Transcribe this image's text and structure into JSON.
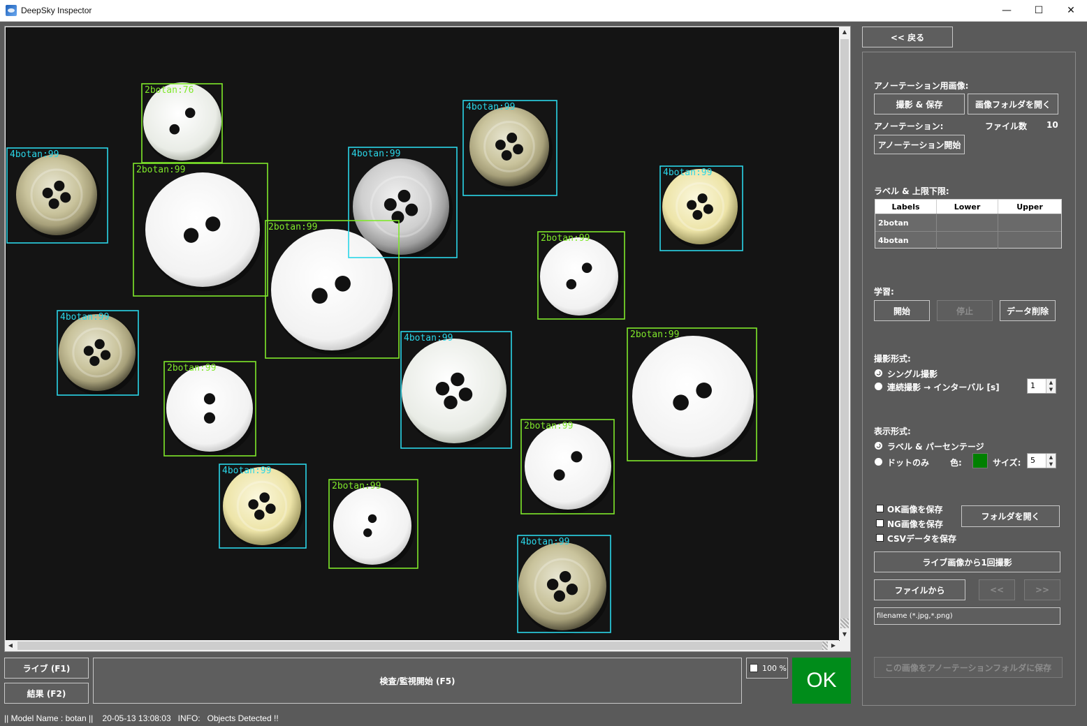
{
  "window": {
    "title": "DeepSky Inspector",
    "minimize_glyph": "—",
    "maximize_glyph": "☐",
    "close_glyph": "✕"
  },
  "viewer": {
    "detections": [
      {
        "label": "2botan:76",
        "class": "2botan"
      },
      {
        "label": "4botan:99",
        "class": "4botan"
      },
      {
        "label": "2botan:99",
        "class": "2botan"
      },
      {
        "label": "4botan:99",
        "class": "4botan"
      },
      {
        "label": "2botan:99",
        "class": "2botan"
      },
      {
        "label": "4botan:99",
        "class": "4botan"
      },
      {
        "label": "4botan:99",
        "class": "4botan"
      },
      {
        "label": "2botan:99",
        "class": "2botan"
      },
      {
        "label": "4botan:99",
        "class": "4botan"
      },
      {
        "label": "2botan:99",
        "class": "2botan"
      },
      {
        "label": "4botan:99",
        "class": "4botan"
      },
      {
        "label": "2botan:99",
        "class": "2botan"
      },
      {
        "label": "2botan:99",
        "class": "2botan"
      },
      {
        "label": "4botan:99",
        "class": "4botan"
      },
      {
        "label": "2botan:99",
        "class": "2botan"
      },
      {
        "label": "4botan:99",
        "class": "4botan"
      }
    ],
    "colors": {
      "2botan": "#7fe82a",
      "4botan": "#2ad6e8"
    }
  },
  "bottom": {
    "live_button": "ライブ (F1)",
    "result_button": "結果 (F2)",
    "inspect_button": "検査/監視開始 (F5)",
    "zoom_label": "100 %",
    "status_result": "OK",
    "status_color": "#008c1a"
  },
  "status": {
    "text": "|| Model Name : botan ||    20-05-13 13:08:03   INFO:   Objects Detected !!"
  },
  "panel": {
    "back_button": "<< 戻る",
    "annotation_image_label": "アノーテーション用画像:",
    "capture_save_button": "撮影 & 保存",
    "open_image_folder_button": "画像フォルダを開く",
    "annotation_label": "アノーテーション:",
    "file_count_label": "ファイル数",
    "file_count_value": "10",
    "annotation_start_button": "アノーテーション開始",
    "label_limits_label": "ラベル & 上限下限:",
    "table": {
      "headers": [
        "Labels",
        "Lower",
        "Upper"
      ],
      "rows": [
        [
          "2botan",
          "",
          ""
        ],
        [
          "4botan",
          "",
          ""
        ]
      ]
    },
    "learning_label": "学習:",
    "start_button": "開始",
    "stop_button": "停止",
    "delete_data_button": "データ削除",
    "capture_mode_label": "撮影形式:",
    "single_capture": "シングル撮影",
    "continuous_capture": "連続撮影 → インターバル [s]",
    "interval_value": "1",
    "display_mode_label": "表示形式:",
    "label_percentage": "ラベル & パーセンテージ",
    "dot_only": "ドットのみ",
    "color_label": "色:",
    "dot_color": "#008000",
    "size_label": "サイズ:",
    "size_value": "5",
    "save_ok": "OK画像を保存",
    "save_ng": "NG画像を保存",
    "save_csv": "CSVデータを保存",
    "open_folder_button": "フォルダを開く",
    "capture_once_button": "ライブ画像から1回撮影",
    "from_file_button": "ファイルから",
    "prev_button": "<<",
    "next_button": ">>",
    "filename_value": "filename (*.jpg,*.png)",
    "save_to_annotation_button": "この画像をアノーテーションフォルダに保存"
  }
}
